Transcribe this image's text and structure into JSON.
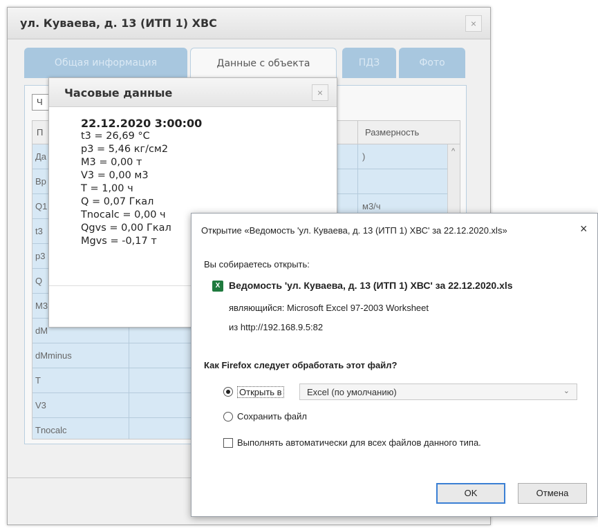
{
  "window": {
    "title": "ул. Куваева, д. 13 (ИТП 1) ХВС",
    "close": "×",
    "tabs": [
      {
        "label": "Общая информация",
        "active": false
      },
      {
        "label": "Данные с объекта",
        "active": true
      },
      {
        "label": "ПДЗ",
        "active": false
      },
      {
        "label": "Фото",
        "active": false
      }
    ],
    "toolbar_button_partial": "Ч"
  },
  "grid": {
    "header": {
      "col1_partial": "П",
      "col3": "Размерность"
    },
    "rows": [
      {
        "c1": "Да",
        "c2": ")"
      },
      {
        "c1": "Вр",
        "c2": ""
      },
      {
        "c1": "Q1",
        "c2": "м3/ч"
      },
      {
        "c1": "t3",
        "c2": ""
      },
      {
        "c1": "p3",
        "c2": ""
      },
      {
        "c1": "Q",
        "c2": ""
      },
      {
        "c1": "M3",
        "c2": ""
      },
      {
        "c1": "dM",
        "c2": ""
      },
      {
        "c1": "dMminus",
        "c2": ""
      },
      {
        "c1": "T",
        "c2": ""
      },
      {
        "c1": "V3",
        "c2": ""
      },
      {
        "c1": "Tnocalc",
        "c2": ""
      }
    ],
    "scroll_up": "^"
  },
  "hourly_popup": {
    "title": "Часовые данные",
    "close": "×",
    "date": "22.12.2020 3:00:00",
    "lines": [
      "t3 = 26,69 °C",
      "p3 = 5,46 кг/см2",
      "M3 = 0,00 т",
      "V3 = 0,00 м3",
      "T = 1,00 ч",
      "Q = 0,07 Гкал",
      "Tnocalc = 0,00 ч",
      "Qgvs = 0,00 Гкал",
      "Mgvs = -0,17 т"
    ]
  },
  "download_dialog": {
    "title": "Открытие «Ведомость 'ул. Куваева, д. 13 (ИТП 1) ХВС' за 22.12.2020.xls»",
    "close": "×",
    "intro": "Вы собираетесь открыть:",
    "file_name": "Ведомость 'ул. Куваева, д. 13 (ИТП 1) ХВС' за 22.12.2020.xls",
    "type_label": "являющийся:",
    "type_value": "Microsoft Excel 97-2003 Worksheet",
    "from_label": "из",
    "from_value": "http://192.168.9.5:82",
    "question": "Как Firefox следует обработать этот файл?",
    "open_with_label": "Открыть в",
    "open_with_value": "Excel (по умолчанию)",
    "open_with_selected": true,
    "save_label": "Сохранить файл",
    "auto_label": "Выполнять автоматически для всех файлов данного типа.",
    "auto_checked": false,
    "ok_label": "OK",
    "cancel_label": "Отмена",
    "file_icon": "excel-file-icon"
  }
}
